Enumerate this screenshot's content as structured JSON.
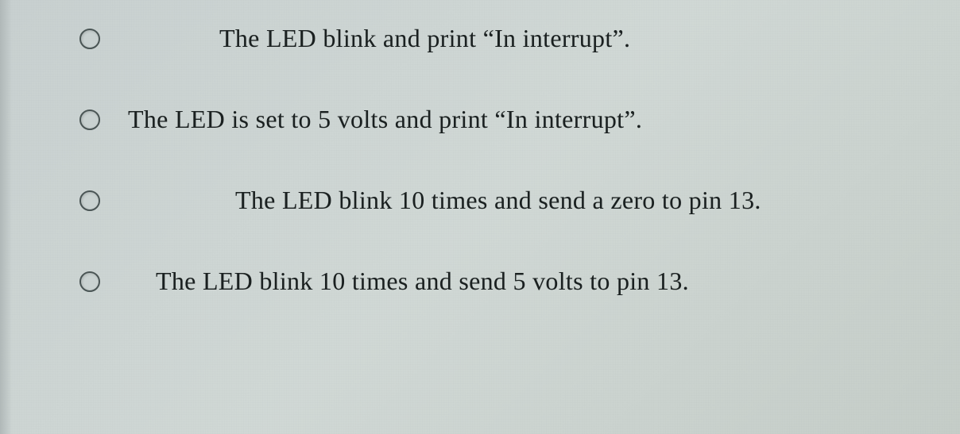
{
  "question": {
    "options": [
      {
        "label": "The LED blink and print “In interrupt”."
      },
      {
        "label": "The LED is set to 5 volts and print “In interrupt”."
      },
      {
        "label": "The LED blink 10 times and send a zero to pin 13."
      },
      {
        "label": "The LED blink 10 times and send 5 volts to pin 13."
      }
    ]
  }
}
